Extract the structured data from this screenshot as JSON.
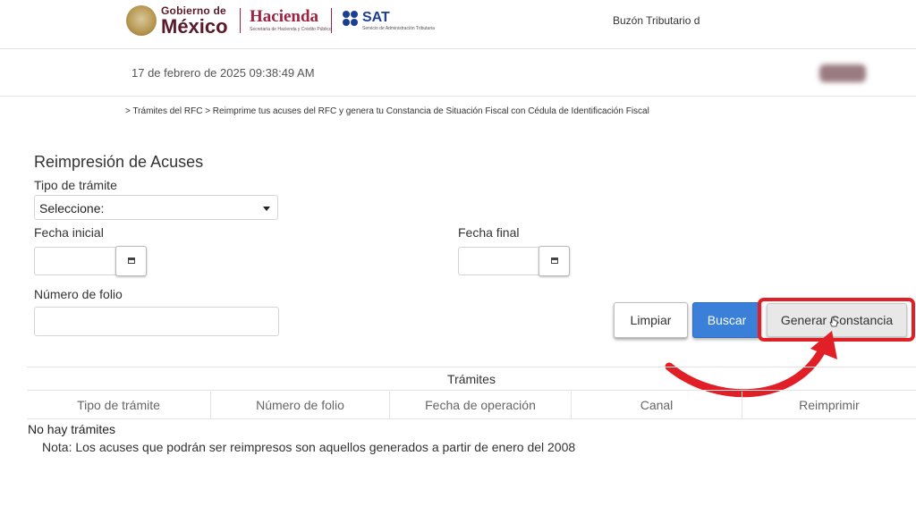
{
  "header": {
    "gobierno_line1": "Gobierno de",
    "gobierno_line2": "México",
    "hacienda": "Hacienda",
    "hacienda_sub": "Secretaría de Hacienda y Crédito Público",
    "sat": "SAT",
    "sat_sub": "Servicio de Administración Tributaria",
    "buzon": "Buzón Tributario d"
  },
  "subheader": {
    "datetime": "17 de febrero de 2025 09:38:49 AM"
  },
  "breadcrumb": "> Trámites del RFC > Reimprime tus acuses del RFC y genera tu Constancia de Situación Fiscal con Cédula de Identificación Fiscal",
  "form": {
    "title": "Reimpresión de Acuses",
    "tipo_label": "Tipo de trámite",
    "tipo_value": "Seleccione:",
    "fecha_inicial_label": "Fecha inicial",
    "fecha_final_label": "Fecha final",
    "folio_label": "Número de folio"
  },
  "buttons": {
    "limpiar": "Limpiar",
    "buscar": "Buscar",
    "generar": "Generar Constancia"
  },
  "table": {
    "title": "Trámites",
    "columns": [
      "Tipo de trámite",
      "Número de folio",
      "Fecha de operación",
      "Canal",
      "Reimprimir"
    ],
    "empty_message": "No hay trámites"
  },
  "note": "Nota: Los acuses que podrán ser reimpresos son aquellos generados a partir de enero del 2008",
  "colors": {
    "gob_guinda": "#9f2241",
    "sat_blue": "#1c3f95",
    "buscar_blue": "#3a7fd8",
    "highlight_red": "#e11f26"
  }
}
